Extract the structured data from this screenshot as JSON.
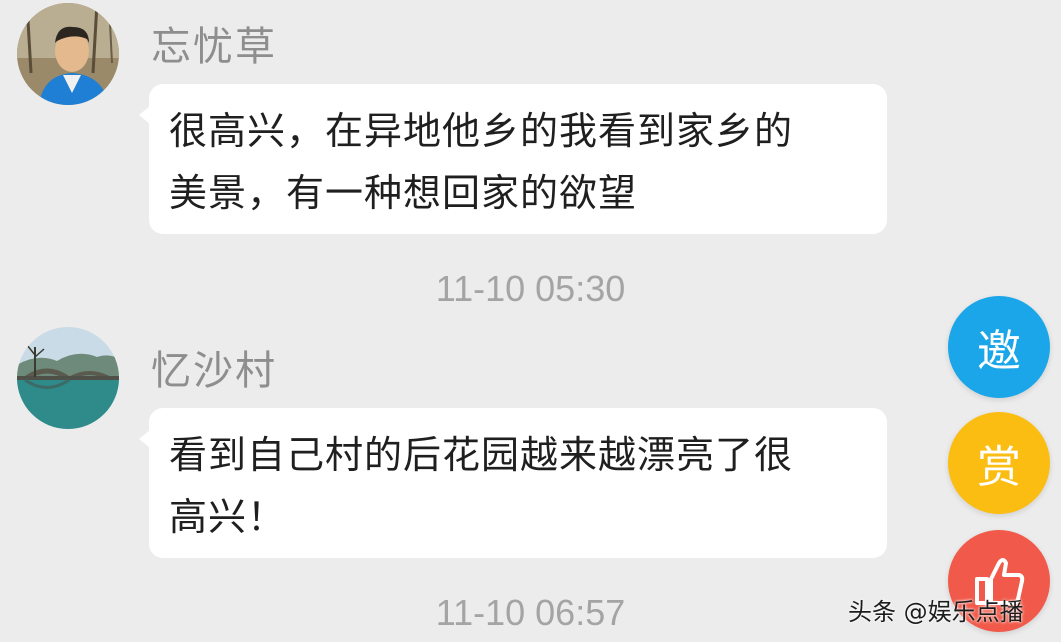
{
  "messages": [
    {
      "sender": "忘忧草",
      "avatar_icon": "avatar-photo-man",
      "text": "很高兴，在异地他乡的我看到家乡的\n美景，有一种想回家的欲望",
      "time": "11-10 05:30"
    },
    {
      "sender": "忆沙村",
      "avatar_icon": "avatar-photo-bridge",
      "text": "看到自己村的后花园越来越漂亮了很\n高兴！",
      "time": "11-10 06:57"
    }
  ],
  "actions": {
    "invite_label": "邀",
    "reward_label": "赏",
    "like_icon": "thumbs-up-icon",
    "invite_color": "#1aa6e8",
    "reward_color": "#fbbd12",
    "like_color": "#f15a4a"
  },
  "watermark": "头条 @娱乐点播",
  "colors": {
    "background": "#ececec",
    "bubble": "#ffffff",
    "sender_text": "#8e8e8e",
    "timestamp_text": "#a4a4a4"
  }
}
